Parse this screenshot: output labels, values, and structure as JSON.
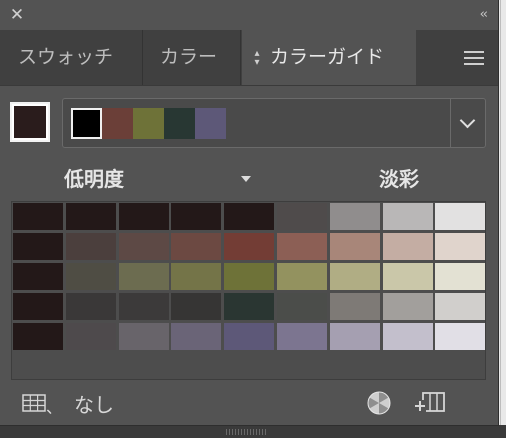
{
  "tabs": [
    "スウォッチ",
    "カラー",
    "カラーガイド"
  ],
  "active_tab_index": 2,
  "current_color": "#2a1c1c",
  "harmony_swatches": [
    "#000000",
    "#6b3f38",
    "#6e7238",
    "#283733",
    "#5d5878"
  ],
  "labels": {
    "left": "低明度",
    "right": "淡彩",
    "none": "なし",
    "separator": "、"
  },
  "variation_grid": [
    [
      "#231818",
      "#231818",
      "#231818",
      "#231818",
      "#231818",
      "#4f4b4b",
      "#908d8d",
      "#b9b7b7",
      "#e2e1e1"
    ],
    [
      "#231818",
      "#4b3f3d",
      "#5d4945",
      "#6c4942",
      "#733d35",
      "#8c5f55",
      "#a88679",
      "#c4ada3",
      "#e0d4cc"
    ],
    [
      "#231818",
      "#4f4d44",
      "#6c6c50",
      "#747448",
      "#6e7238",
      "#93925f",
      "#b0ad84",
      "#cac7a9",
      "#e3e1d3"
    ],
    [
      "#231818",
      "#3a3838",
      "#3c3a3a",
      "#363534",
      "#2a3632",
      "#4b4d4a",
      "#7e7a76",
      "#a29f9c",
      "#d1cfcc"
    ],
    [
      "#231818",
      "#4e4a4c",
      "#68646a",
      "#6a6477",
      "#5d5878",
      "#7c7590",
      "#a59fb1",
      "#c3bfcc",
      "#e1dfe6"
    ]
  ],
  "icons": {
    "close": "close-icon",
    "collapse": "double-chevron-icon",
    "menu": "hamburger-menu-icon",
    "swatch_view": "grid-icon",
    "edit_colors": "color-wheel-icon",
    "save_group": "save-to-swatches-icon"
  }
}
